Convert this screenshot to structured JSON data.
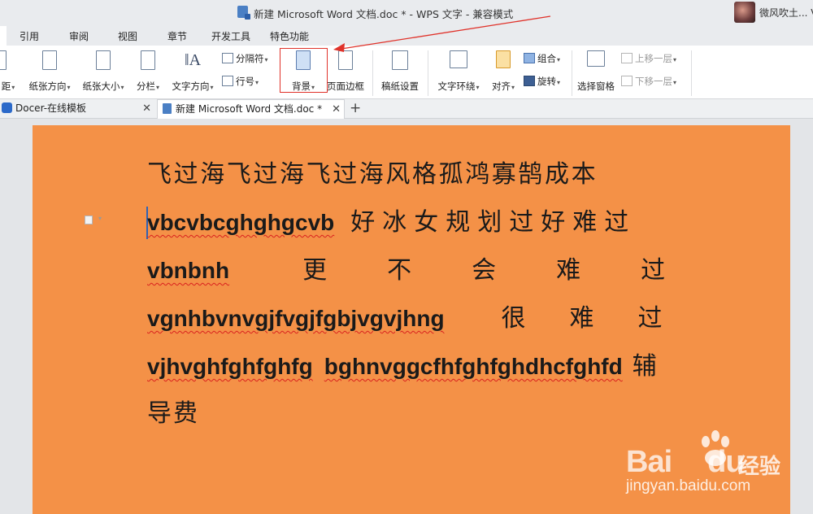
{
  "window": {
    "title": "新建 Microsoft Word 文档.doc * - WPS 文字 - 兼容模式",
    "user_name": "微风吹土... V"
  },
  "menu": {
    "items": [
      "引用",
      "审阅",
      "视图",
      "章节",
      "开发工具",
      "特色功能"
    ]
  },
  "ribbon": {
    "margin_label": "距",
    "orientation_label": "纸张方向",
    "size_label": "纸张大小",
    "columns_label": "分栏",
    "text_direction_label": "文字方向",
    "separator_label": "分隔符",
    "line_number_label": "行号",
    "background_label": "背景",
    "page_border_label": "页面边框",
    "draft_label": "稿纸设置",
    "text_wrap_label": "文字环绕",
    "align_label": "对齐",
    "group_label": "组合",
    "rotate_label": "旋转",
    "selection_pane_label": "选择窗格",
    "bring_forward_label": "上移一层",
    "send_backward_label": "下移一层"
  },
  "doc_tabs": [
    {
      "label": "Docer-在线模板",
      "active": false
    },
    {
      "label": "新建 Microsoft Word 文档.doc *",
      "active": true
    }
  ],
  "document": {
    "background_color": "#f49147",
    "line1": "飞过海飞过海飞过海风格孤鸿寡鹄成本",
    "line2_en": "vbcvbcghghgcvb",
    "line2_cn": "好冰女规划过好难过",
    "line3_en": "vbnbnh",
    "line3_cn": "更不会难过",
    "line4_en": "vgnhbvnvgjfvgjfgbjvgvjhng",
    "line4_cn": "很难过",
    "line5_en1": "vjhvghfghfghfg",
    "line5_en2": "bghnvggcfhfghfghdhcfghfd",
    "line5_cn": "辅",
    "line6": "导费"
  },
  "watermark": {
    "brand": "Bai",
    "brand_suffix": "du",
    "product": "经验",
    "url": "jingyan.baidu.com"
  },
  "colors": {
    "highlight": "#e0322a",
    "accent": "#2b69c9"
  }
}
